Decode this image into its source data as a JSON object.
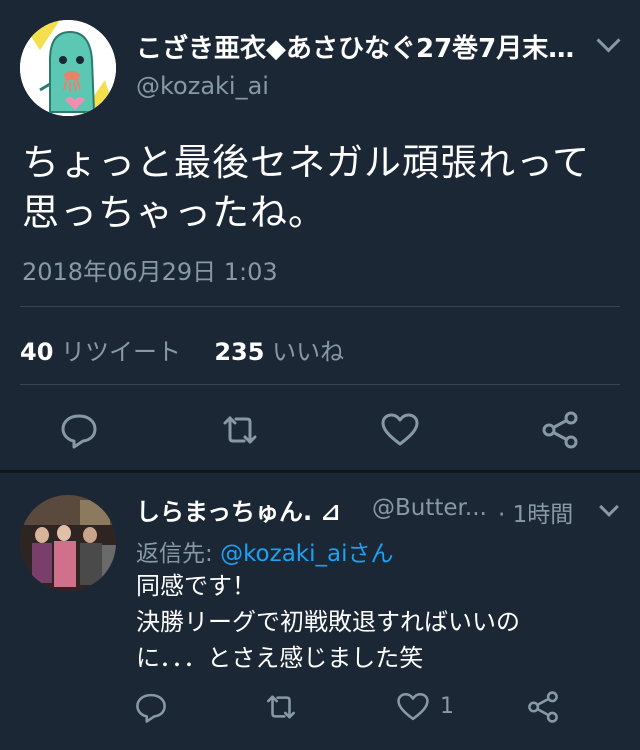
{
  "tweet": {
    "display_name": "こざき亜衣◆あさひなぐ27巻7月末…",
    "handle": "@kozaki_ai",
    "body_line1": "ちょっと最後セネガル頑張れって",
    "body_line2": "思っちゃったね。",
    "timestamp": "2018年06月29日 1:03",
    "retweets_count": "40",
    "retweets_label": "リツイート",
    "likes_count": "235",
    "likes_label": "いいね"
  },
  "reply": {
    "display_name": "しらまっちゅん. ⊿",
    "handle": "@Butter...",
    "time": "· 1時間",
    "reply_to_label": "返信先:",
    "reply_to_handle": "@kozaki_ai",
    "reply_to_suffix": "さん",
    "body_line1": "同感です！",
    "body_line2": "決勝リーグで初戦敗退すればいいの",
    "body_line3": "に．．．とさえ感じました笑",
    "like_count": "1"
  },
  "icons": {
    "reply": "reply-icon",
    "retweet": "retweet-icon",
    "like": "heart-icon",
    "share": "share-icon",
    "menu": "chevron-down-icon"
  },
  "colors": {
    "background": "#1b2735",
    "secondary_text": "#8899a6",
    "link": "#1da1f2",
    "divider": "#38444d"
  }
}
